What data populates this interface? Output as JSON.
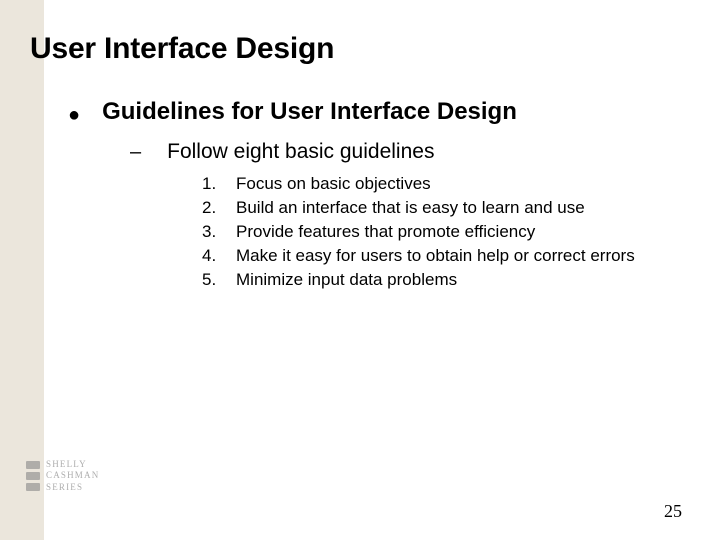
{
  "title": "User Interface Design",
  "bullet": {
    "marker": "●",
    "text": "Guidelines for User Interface Design"
  },
  "dash": {
    "marker": "–",
    "text": "Follow eight basic guidelines"
  },
  "items": [
    {
      "num": "1.",
      "text": "Focus on basic objectives"
    },
    {
      "num": "2.",
      "text": "Build an interface that is easy to learn and use"
    },
    {
      "num": "3.",
      "text": "Provide features that promote efficiency"
    },
    {
      "num": "4.",
      "text": "Make it easy for users to obtain help or correct errors"
    },
    {
      "num": "5.",
      "text": "Minimize input data problems"
    }
  ],
  "logo": {
    "line1": "SHELLY",
    "line2": "CASHMAN",
    "line3": "SERIES"
  },
  "page_number": "25"
}
